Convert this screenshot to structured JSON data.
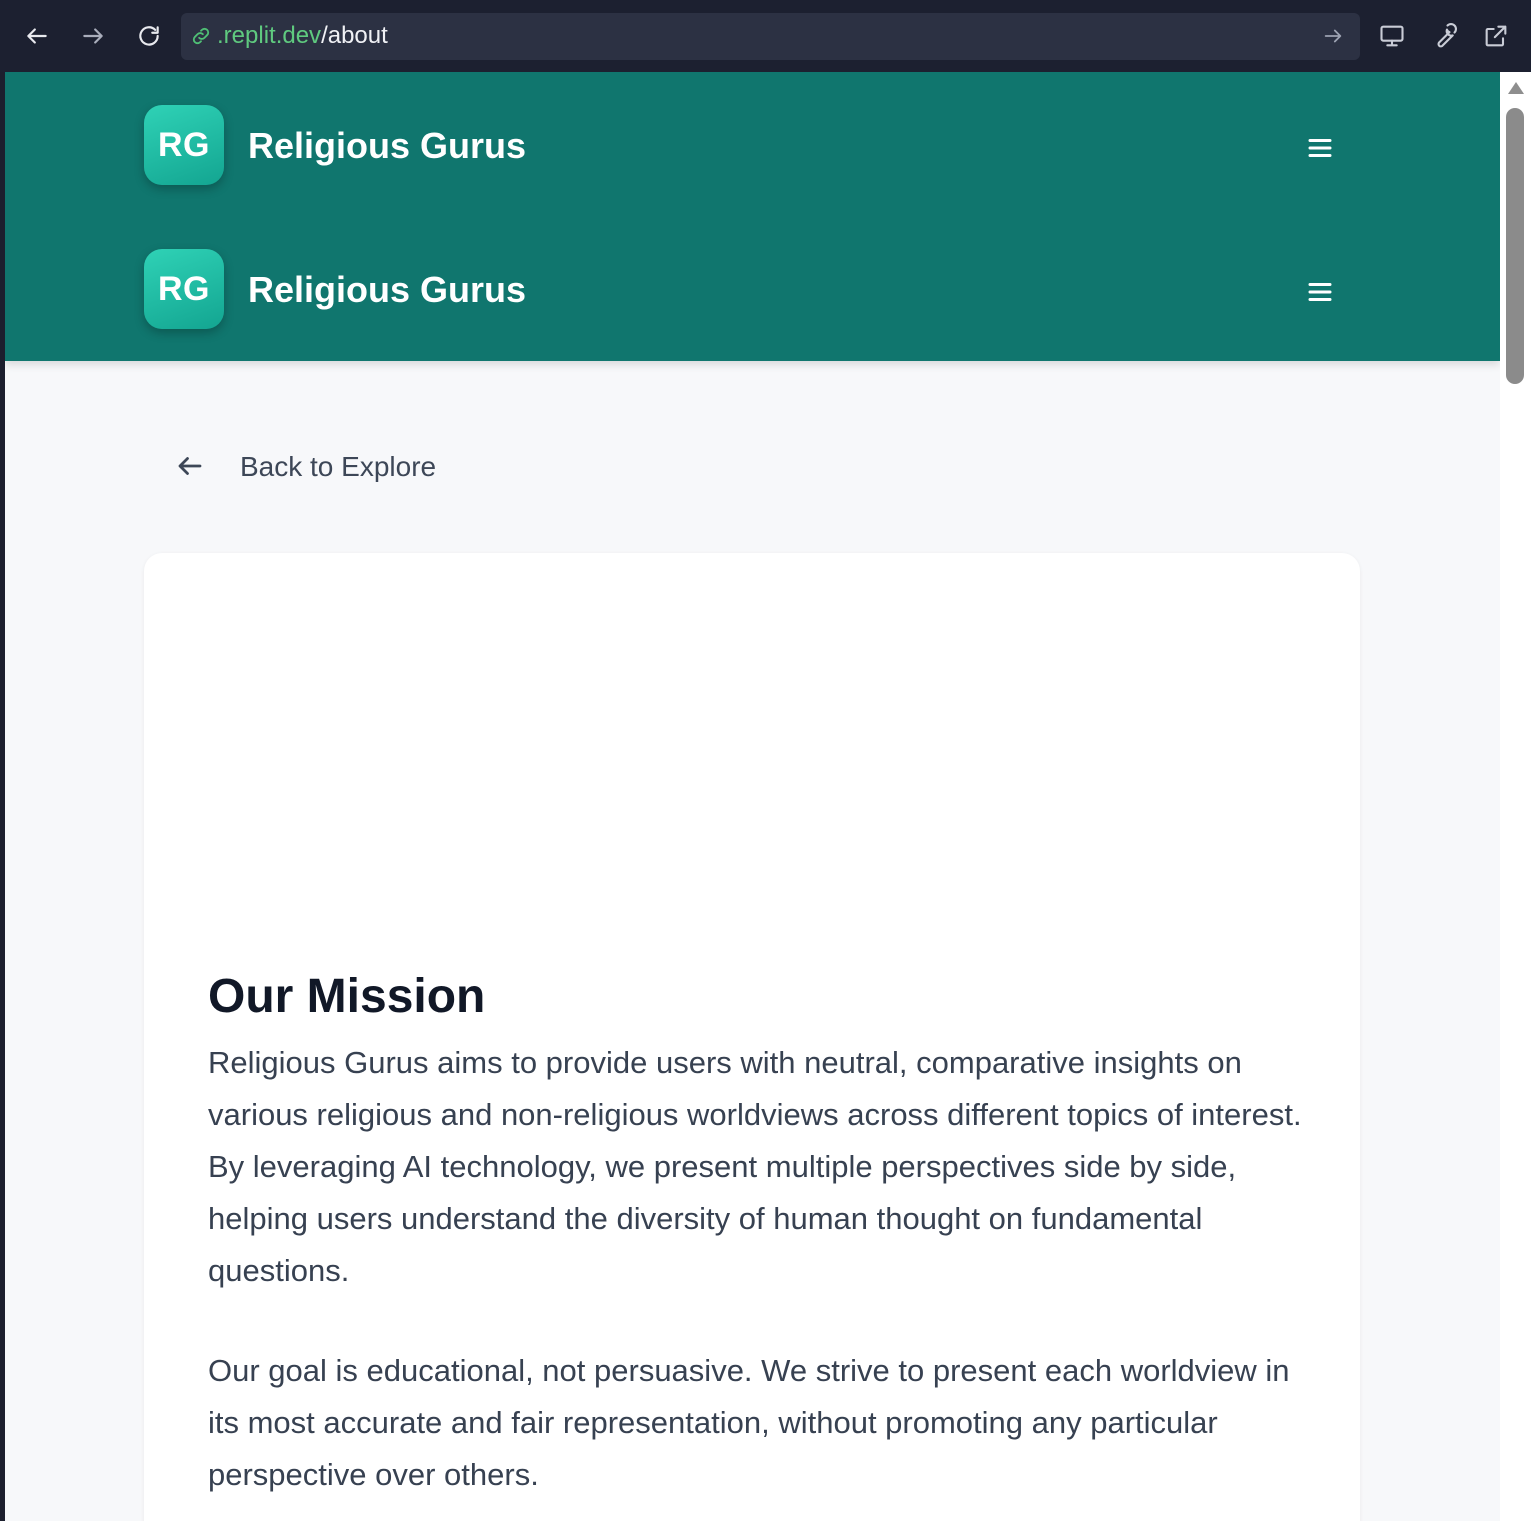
{
  "browser": {
    "url_domain": ".replit.dev",
    "url_path": "/about",
    "icons": [
      "back-icon",
      "forward-icon",
      "reload-icon",
      "link-icon",
      "go-arrow-icon",
      "monitor-icon",
      "wrench-icon",
      "external-link-icon"
    ]
  },
  "header": {
    "rows": [
      {
        "badge": "RG",
        "title": "Religious Gurus"
      },
      {
        "badge": "RG",
        "title": "Religious Gurus"
      }
    ],
    "color": "#10766e"
  },
  "back_link": {
    "label": "Back to Explore"
  },
  "mission": {
    "title": "Our Mission",
    "paragraphs": [
      "Religious Gurus aims to provide users with neutral, comparative insights on various religious and non-religious worldviews across different topics of interest. By leveraging AI technology, we present multiple perspectives side by side, helping users understand the diversity of human thought on fundamental questions.",
      "Our goal is educational, not persuasive. We strive to present each worldview in its most accurate and fair representation, without promoting any particular perspective over others."
    ]
  }
}
